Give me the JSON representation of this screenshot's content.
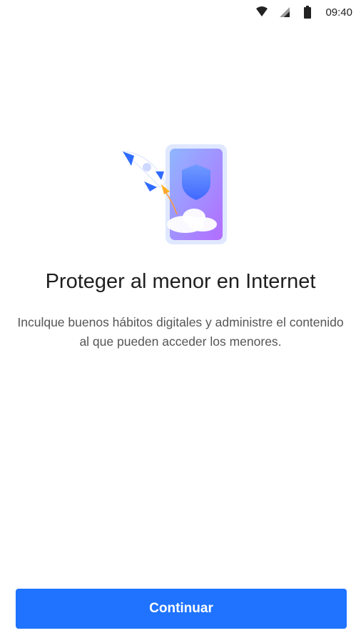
{
  "status_bar": {
    "time": "09:40",
    "icons": [
      "wifi-icon",
      "cellular-signal-icon",
      "battery-icon"
    ]
  },
  "hero": {
    "illustration": "rocket-phone-shield-illustration",
    "colors": {
      "phone_gradient_start": "#7aa6ff",
      "phone_gradient_end": "#b06cff",
      "shield": "#4d7fff",
      "rocket": "#2f6bff"
    }
  },
  "main": {
    "title": "Proteger al menor en Internet",
    "description": "Inculque buenos hábitos digitales y administre el contenido al que pueden acceder los menores."
  },
  "footer": {
    "continue_label": "Continuar",
    "button_color": "#1f73ff"
  }
}
